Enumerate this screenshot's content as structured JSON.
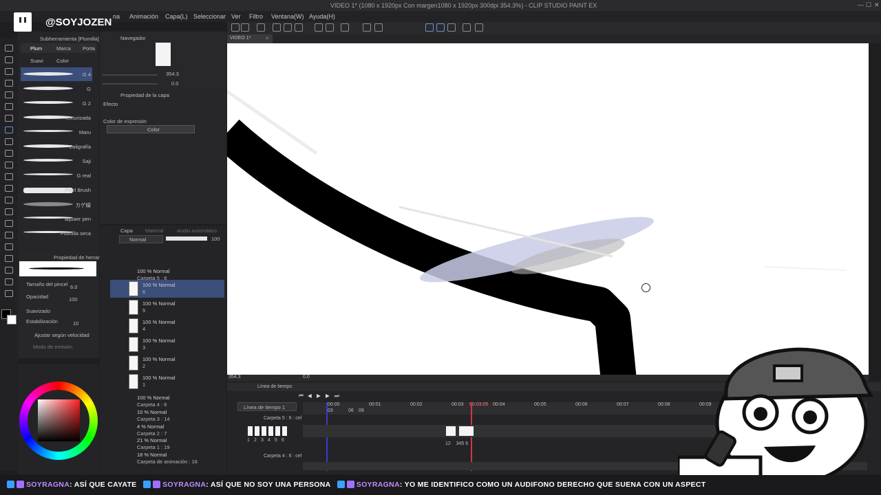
{
  "window": {
    "title": "VIDEO 1* (1080 x 1920px Con margen1080 x 1920px 300dpi 354.3%)  - CLIP STUDIO PAINT EX"
  },
  "menu": [
    "na",
    "Animación",
    "Capa(L)",
    "Seleccionar",
    "Ver",
    "Filtro",
    "Ventana(W)",
    "Ayuda(H)"
  ],
  "stream": {
    "handle": "@SOYJOZEN"
  },
  "subtool": {
    "header": "Subherramienta [Plumilla]",
    "tabs": [
      "Plum",
      "Marca",
      "Porta",
      "Suavi",
      "Color"
    ],
    "brushes": [
      "G 4",
      "G",
      "G 2",
      "Texturizada",
      "Maru",
      "Caligrafía",
      "Saji",
      "G real",
      "Pixel Brush",
      "カゲ線",
      "aquaer pen",
      "Plumilla seca"
    ]
  },
  "navigator": {
    "title": "Navegador",
    "zoom": "354.3",
    "angle": "0.0"
  },
  "layer_property": {
    "title": "Propiedad de la capa",
    "effect_label": "Efecto",
    "expression_label": "Color de expresión",
    "expression_value": "Color"
  },
  "tool_property": {
    "title": "Propiedad de herram",
    "brush_size_label": "Tamaño del pincel",
    "brush_size_value": "6.0",
    "opacity_label": "Opacidad",
    "opacity_value": "100",
    "smoothing_label": "Suavizado",
    "stabilization_label": "Estabilización",
    "stabilization_value": "10",
    "speed_label": "Ajustar según velocidad",
    "mode_label": "Modo de emisión"
  },
  "layers_panel": {
    "tabs": [
      "Capa",
      "Material",
      "Audio automático"
    ],
    "blend_mode": "Normal",
    "opacity": "100",
    "rows": [
      {
        "t1": "100 % Normal",
        "t2": "Carpeta 5 : 6"
      },
      {
        "t1": "100 % Normal",
        "t2": "6"
      },
      {
        "t1": "100 % Normal",
        "t2": "5"
      },
      {
        "t1": "100 % Normal",
        "t2": "4"
      },
      {
        "t1": "100 % Normal",
        "t2": "3"
      },
      {
        "t1": "100 % Normal",
        "t2": "2"
      },
      {
        "t1": "100 % Normal",
        "t2": "1"
      },
      {
        "t1": "100 % Normal",
        "t2": "Carpeta 4 : 6"
      },
      {
        "t1": "10 % Normal",
        "t2": "Carpeta 3 : 14"
      },
      {
        "t1": "4 % Normal",
        "t2": "Carpeta 2 : 7"
      },
      {
        "t1": "21 % Normal",
        "t2": "Carpeta 1 : 19"
      },
      {
        "t1": "18 % Normal",
        "t2": "Carpeta de animación : 16"
      }
    ]
  },
  "canvas": {
    "tab": "VIDEO 1*",
    "status_zoom": "354.3",
    "status_angle": "0.0"
  },
  "timeline": {
    "title": "Línea de tiempo",
    "name": "Línea de tiempo 1",
    "current_time": "00:03:05",
    "seconds": [
      "00:00",
      "00:01",
      "00:02",
      "00:03",
      "00:04",
      "00:05",
      "00:06",
      "00:07",
      "00:08",
      "00:09"
    ],
    "frame_ticks": [
      "03",
      "06",
      "09"
    ],
    "track1": "Carpeta 5 : 6 : cel",
    "track2": "Carpeta 4 : 6 : cel",
    "cells_left": [
      "1",
      "2",
      "3",
      "4",
      "5",
      "6"
    ],
    "cells_right": "12    345 6"
  },
  "chat": [
    {
      "nick": "SOYRAGNA",
      "text": "ASÍ QUE CAYATE"
    },
    {
      "nick": "SOYRAGNA",
      "text": "ASÍ QUE NO SOY UNA PERSONA"
    },
    {
      "nick": "SOYRAGNA",
      "text": "YO ME IDENTIFICO COMO UN AUDIFONO DERECHO QUE SUENA CON UN ASPECT"
    }
  ],
  "colors": {
    "accent": "#3c4e7a",
    "chat_nick": "#c18cff",
    "playhead": "#d03a3a"
  }
}
